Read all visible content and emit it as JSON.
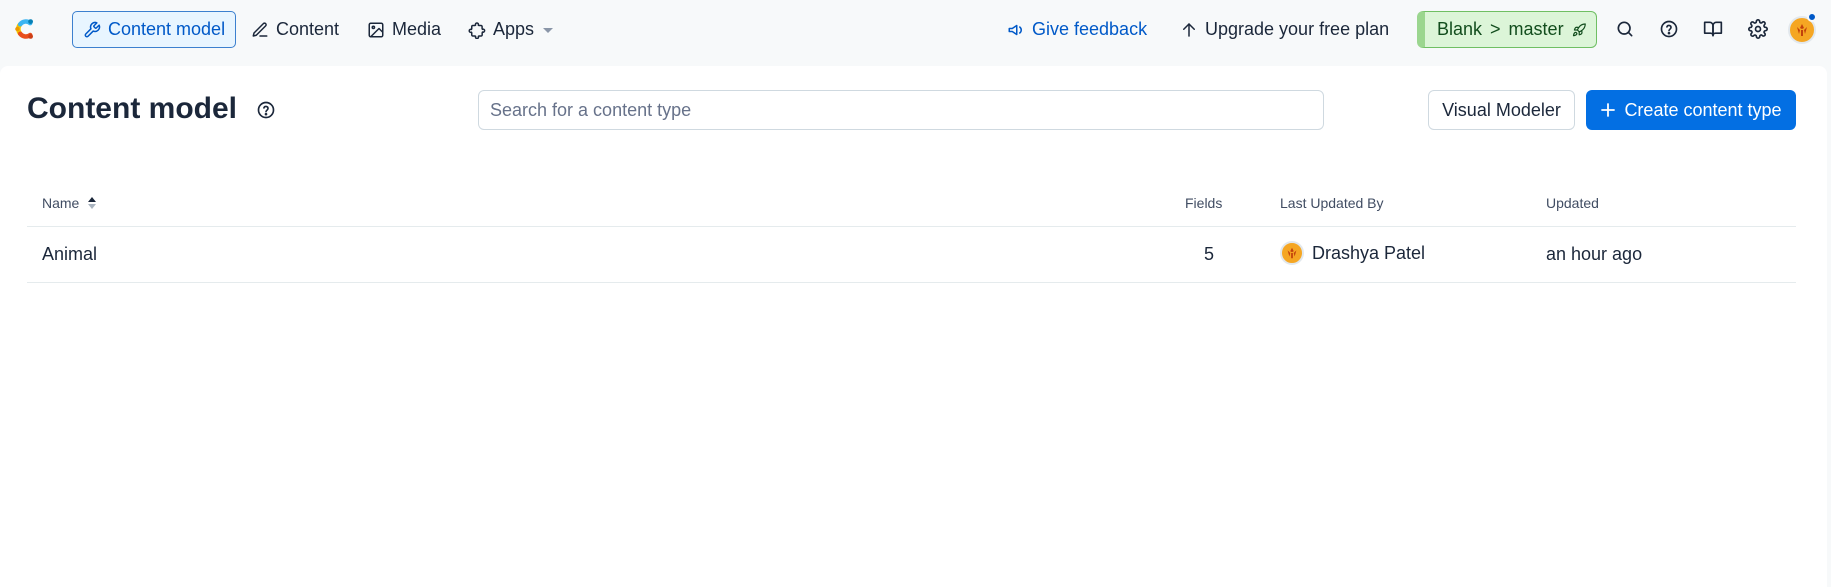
{
  "nav": {
    "items": [
      {
        "label": "Content model",
        "icon": "wrench-icon",
        "active": true
      },
      {
        "label": "Content",
        "icon": "pen-icon",
        "active": false
      },
      {
        "label": "Media",
        "icon": "image-icon",
        "active": false
      },
      {
        "label": "Apps",
        "icon": "puzzle-icon",
        "active": false
      }
    ],
    "feedback_label": "Give feedback",
    "upgrade_label": "Upgrade your free plan",
    "env": {
      "space": "Blank",
      "separator": ">",
      "environment": "master"
    }
  },
  "page": {
    "title": "Content model",
    "search_placeholder": "Search for a content type",
    "visual_modeler_label": "Visual Modeler",
    "create_label": "Create content type"
  },
  "table": {
    "headers": {
      "name": "Name",
      "fields": "Fields",
      "last_updated_by": "Last Updated By",
      "updated": "Updated"
    },
    "rows": [
      {
        "name": "Animal",
        "fields": "5",
        "last_updated_by": "Drashya Patel",
        "updated": "an hour ago"
      }
    ]
  },
  "colors": {
    "accent": "#036fe3",
    "active_nav_bg": "#e8f5ff",
    "env_chip_bg": "#dcf5d8",
    "avatar": "#f5a623"
  }
}
